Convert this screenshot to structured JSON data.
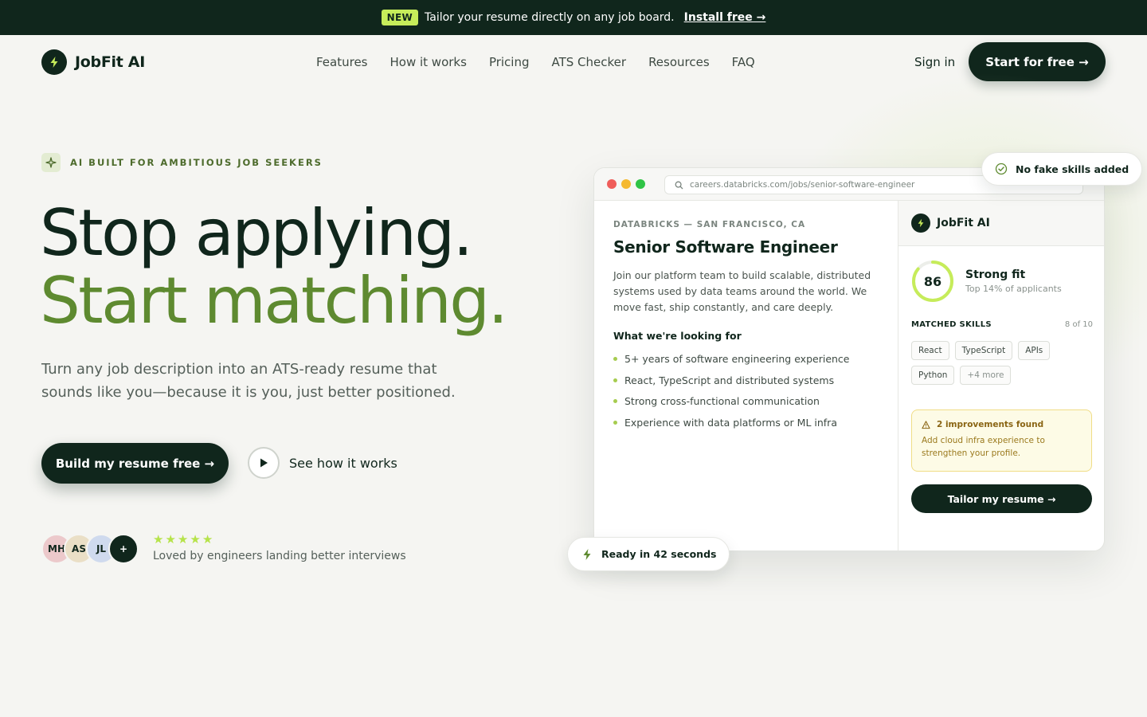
{
  "announcement": {
    "badge": "NEW",
    "text": "Tailor your resume directly on any job board.",
    "link": "Install free →"
  },
  "header": {
    "brand": "JobFit AI",
    "nav": [
      "Features",
      "How it works",
      "Pricing",
      "ATS Checker",
      "Resources",
      "FAQ"
    ],
    "signin": "Sign in",
    "cta": "Start for free →"
  },
  "hero": {
    "eyebrow": "AI BUILT FOR AMBITIOUS JOB SEEKERS",
    "headline_1": "Stop applying.",
    "headline_2": "Start matching.",
    "subhead": "Turn any job description into an ATS-ready resume that sounds like you—because it is you, just better positioned.",
    "cta_primary": "Build my resume free →",
    "cta_secondary": "See how it works",
    "avatars": [
      "MH",
      "AS",
      "JL",
      "+"
    ],
    "rating_stars": 5,
    "social_proof": "Loved by engineers landing better interviews"
  },
  "mockup": {
    "url": "careers.databricks.com/jobs/senior-software-engineer",
    "job": {
      "company": "DATABRICKS — SAN FRANCISCO, CA",
      "title": "Senior Software Engineer",
      "description": "Join our platform team to build scalable, distributed systems used by data teams around the world. We move fast, ship constantly, and care deeply.",
      "looking_for": "What we're looking for",
      "requirements": [
        "5+ years of software engineering experience",
        "React, TypeScript and distributed systems",
        "Strong cross-functional communication",
        "Experience with data platforms or ML infra"
      ]
    },
    "panel": {
      "brand": "JobFit AI",
      "score": 86,
      "fit_title": "Strong fit",
      "fit_sub": "Top 14% of applicants",
      "skills_label": "MATCHED SKILLS",
      "skills_count": "8 of 10",
      "skills": [
        "React",
        "TypeScript",
        "APIs",
        "Python"
      ],
      "skills_more": "+4 more",
      "improve_title": "2 improvements found",
      "improve_body": "Add cloud infra experience to strengthen your profile.",
      "tailor_button": "Tailor my resume →"
    },
    "badge_top": "No fake skills added",
    "badge_bottom": "Ready in 42 seconds"
  },
  "colors": {
    "dark": "#10261c",
    "accent_green": "#5e8a30",
    "lime": "#c6ec5a",
    "background": "#f5f5f2"
  }
}
